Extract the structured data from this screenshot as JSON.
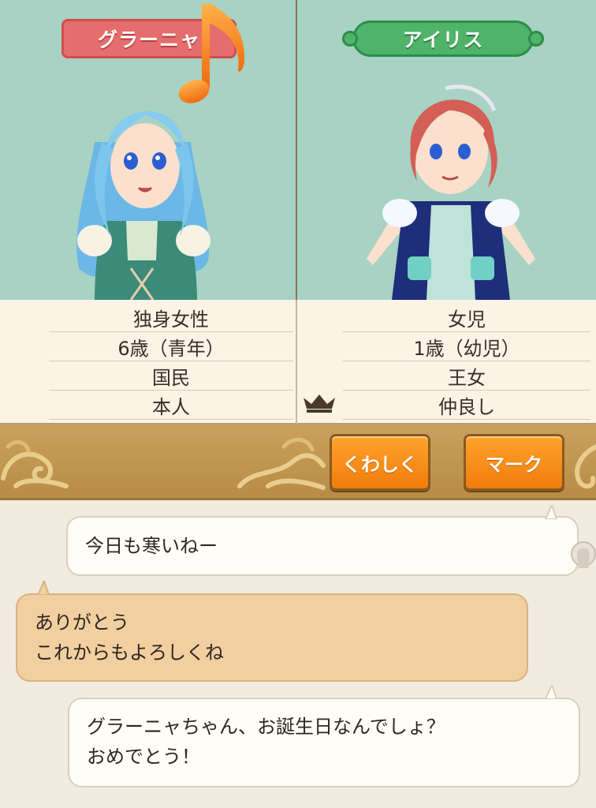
{
  "left_character": {
    "name": "グラーニャ",
    "rows": [
      "独身女性",
      "6歳（青年）",
      "国民",
      "本人"
    ],
    "hair_color": "#7cc6ee",
    "tag_color": "#e56d6d"
  },
  "right_character": {
    "name": "アイリス",
    "rows": [
      "女児",
      "1歳（幼児）",
      "王女",
      "仲良し"
    ],
    "hair_color": "#d35f56",
    "tag_color": "#4fb46a"
  },
  "relation_icon": "crown-icon",
  "toolbar": {
    "detail_label": "くわしく",
    "mark_label": "マーク"
  },
  "chat": {
    "messages": [
      {
        "side": "right",
        "lines": [
          "今日も寒いねー"
        ]
      },
      {
        "side": "left",
        "lines": [
          "ありがとう",
          "これからもよろしくね"
        ]
      },
      {
        "side": "right",
        "lines": [
          "グラーニャちゃん、お誕生日なんでしょ？",
          "おめでとう！"
        ]
      }
    ]
  },
  "colors": {
    "panel_bg": "#a8d2c3",
    "accent_orange": "#f5901a",
    "toolbar_gold": "#c9a15d"
  }
}
